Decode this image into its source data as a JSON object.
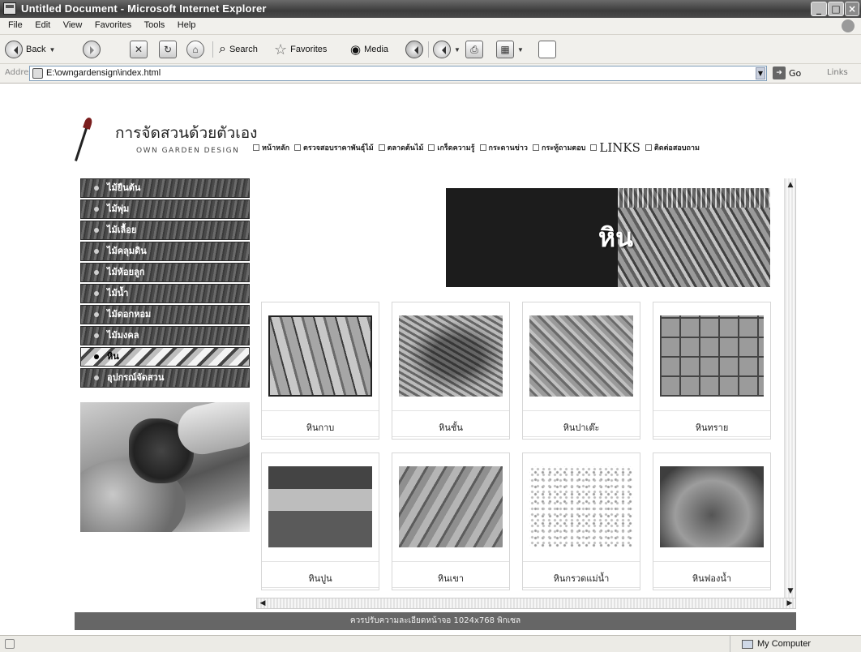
{
  "window": {
    "title": "Untitled Document - Microsoft Internet Explorer",
    "buttons": [
      "_",
      "□",
      "×"
    ]
  },
  "menubar": [
    "File",
    "Edit",
    "View",
    "Favorites",
    "Tools",
    "Help"
  ],
  "toolbar": {
    "back": "Back",
    "search": "Search",
    "favorites": "Favorites",
    "media": "Media"
  },
  "addressbar": {
    "label": "Address",
    "url": "E:\\owngardensign\\index.html",
    "go": "Go",
    "links": "Links"
  },
  "site": {
    "brand_th": "การจัดสวนด้วยตัวเอง",
    "brand_en": "OWN GARDEN DESIGN",
    "nav": [
      "หน้าหลัก",
      "ตรวจสอบราคาพันธุ์ไม้",
      "ตลาดต้นไม้",
      "เกร็ดความรู้",
      "กระดานข่าว",
      "กระทู้ถามตอบ",
      "LINKS",
      "ติดต่อสอบถาม"
    ],
    "categories": [
      "ไม้ยืนต้น",
      "ไม้พุ่ม",
      "ไม้เลื้อย",
      "ไม้คลุมดิน",
      "ไม้ห้อยลูก",
      "ไม้น้ำ",
      "ไม้ดอกหอม",
      "ไม้มงคล",
      "หิน",
      "อุปกรณ์จัดสวน"
    ],
    "active_category": "หิน",
    "banner_title": "หิน",
    "products": [
      {
        "name": "หินกาบ"
      },
      {
        "name": "หินชั้น"
      },
      {
        "name": "หินปาเต๊ะ"
      },
      {
        "name": "หินทราย"
      },
      {
        "name": "หินปูน"
      },
      {
        "name": "หินเขา"
      },
      {
        "name": "หินกรวดแม่น้ำ"
      },
      {
        "name": "หินฟองน้ำ"
      }
    ],
    "footer": "ควรปรับความละเอียดหน้าจอ 1024x768 พิกเซล"
  },
  "statusbar": {
    "zone": "My Computer"
  }
}
